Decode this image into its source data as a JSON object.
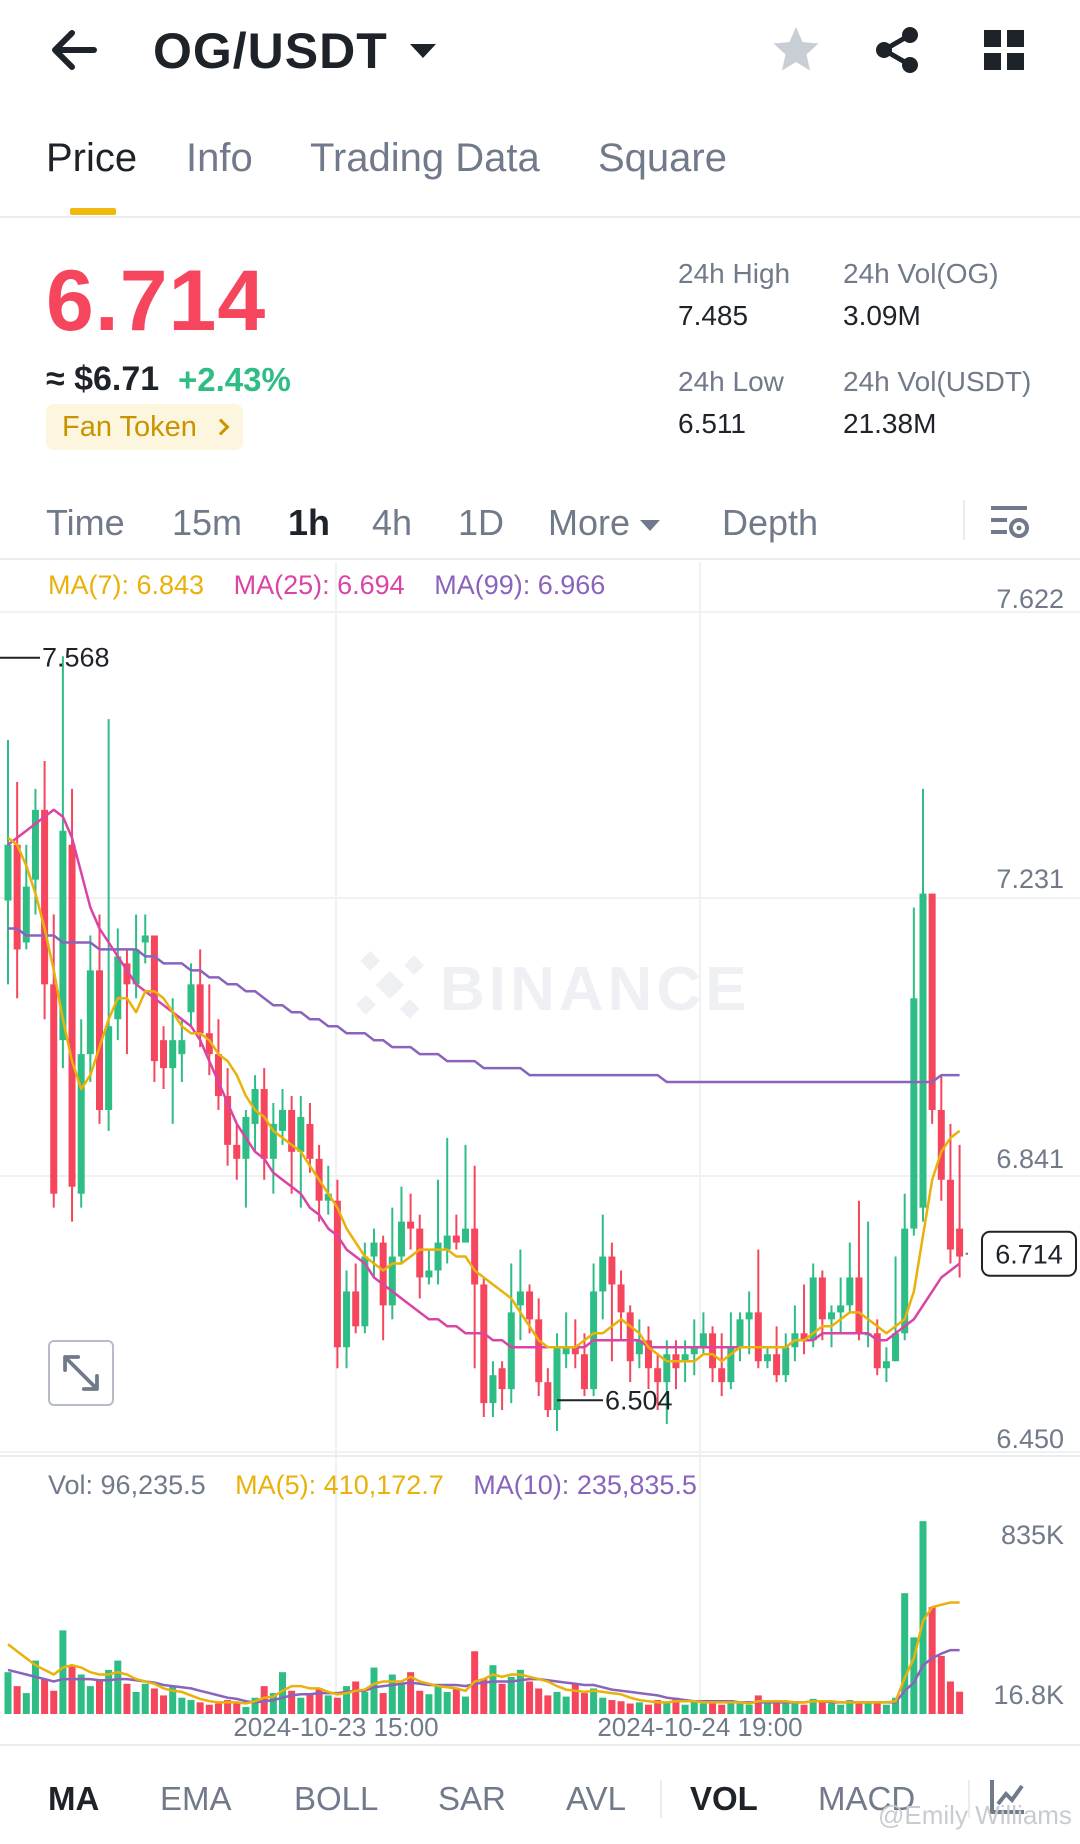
{
  "header": {
    "pair": "OG/USDT"
  },
  "tabs": [
    {
      "label": "Price",
      "active": true
    },
    {
      "label": "Info",
      "active": false
    },
    {
      "label": "Trading Data",
      "active": false
    },
    {
      "label": "Square",
      "active": false
    }
  ],
  "ticker": {
    "last_price": "6.714",
    "usd_price": "≈ $6.71",
    "change_pct": "+2.43%",
    "badge": "Fan Token",
    "stats": {
      "high_label": "24h High",
      "high_value": "7.485",
      "vol_og_label": "24h Vol(OG)",
      "vol_og_value": "3.09M",
      "low_label": "24h Low",
      "low_value": "6.511",
      "vol_usdt_label": "24h Vol(USDT)",
      "vol_usdt_value": "21.38M"
    }
  },
  "intervals": [
    {
      "label": "Time",
      "active": false
    },
    {
      "label": "15m",
      "active": false
    },
    {
      "label": "1h",
      "active": true
    },
    {
      "label": "4h",
      "active": false
    },
    {
      "label": "1D",
      "active": false
    },
    {
      "label": "More",
      "active": false
    },
    {
      "label": "Depth",
      "active": false
    }
  ],
  "indicators": [
    {
      "label": "MA",
      "active": true
    },
    {
      "label": "EMA",
      "active": false
    },
    {
      "label": "BOLL",
      "active": false
    },
    {
      "label": "SAR",
      "active": false
    },
    {
      "label": "AVL",
      "active": false
    },
    {
      "label": "VOL",
      "active": true
    },
    {
      "label": "MACD",
      "active": false
    }
  ],
  "credit": "@Emily Williams",
  "colors": {
    "up": "#2ebd85",
    "down": "#f6465d",
    "ma7": "#e9b10a",
    "ma25": "#d944a6",
    "ma99": "#8a63bd",
    "accent": "#f0b90b"
  },
  "chart_data": {
    "type": "candlestick",
    "interval": "1h",
    "watermark": "BINANCE",
    "price_axis_ticks": [
      "7.622",
      "7.231",
      "6.841",
      "6.450"
    ],
    "price_range": [
      6.45,
      7.622
    ],
    "current_price_label": "6.714",
    "max_marker": "7.568",
    "min_marker": "6.504",
    "ma_legend": [
      {
        "name": "MA(7)",
        "value": "6.843",
        "text": "MA(7): 6.843"
      },
      {
        "name": "MA(25)",
        "value": "6.694",
        "text": "MA(25): 6.694"
      },
      {
        "name": "MA(99)",
        "value": "6.966",
        "text": "MA(99): 6.966"
      }
    ],
    "x_labels": [
      "2024-10-23 15:00",
      "2024-10-24 19:00"
    ],
    "volume": {
      "axis_ticks": [
        "835K",
        "16.8K"
      ],
      "legend": [
        {
          "name": "Vol",
          "text": "Vol: 96,235.5"
        },
        {
          "name": "MA(5)",
          "text": "MA(5): 410,172.7"
        },
        {
          "name": "MA(10)",
          "text": "MA(10): 235,835.5"
        }
      ]
    },
    "candles": [
      [
        7.22,
        7.3,
        7.45,
        7.1
      ],
      [
        7.3,
        7.15,
        7.39,
        7.08
      ],
      [
        7.16,
        7.24,
        7.3,
        7.15
      ],
      [
        7.25,
        7.35,
        7.38,
        7.2
      ],
      [
        7.35,
        7.1,
        7.42,
        7.05
      ],
      [
        7.1,
        6.8,
        7.2,
        6.78
      ],
      [
        7.02,
        7.32,
        7.57,
        6.98
      ],
      [
        7.3,
        6.81,
        7.38,
        6.76
      ],
      [
        6.8,
        7.0,
        7.05,
        6.78
      ],
      [
        7.0,
        7.12,
        7.17,
        6.96
      ],
      [
        7.12,
        6.92,
        7.2,
        6.9
      ],
      [
        6.92,
        7.04,
        7.48,
        6.89
      ],
      [
        7.05,
        7.14,
        7.18,
        7.02
      ],
      [
        7.13,
        7.1,
        7.15,
        7.0
      ],
      [
        7.1,
        7.15,
        7.2,
        7.08
      ],
      [
        7.16,
        7.17,
        7.2,
        7.13
      ],
      [
        7.17,
        6.99,
        7.17,
        6.96
      ],
      [
        7.02,
        6.98,
        7.04,
        6.95
      ],
      [
        6.98,
        7.02,
        7.08,
        6.9
      ],
      [
        7.0,
        7.02,
        7.05,
        6.96
      ],
      [
        7.06,
        7.1,
        7.13,
        7.04
      ],
      [
        7.1,
        7.03,
        7.15,
        7.01
      ],
      [
        7.03,
        7.0,
        7.1,
        6.97
      ],
      [
        7.0,
        6.94,
        7.05,
        6.92
      ],
      [
        6.94,
        6.87,
        6.98,
        6.84
      ],
      [
        6.87,
        6.85,
        6.9,
        6.82
      ],
      [
        6.85,
        6.91,
        6.92,
        6.78
      ],
      [
        6.9,
        6.95,
        6.97,
        6.86
      ],
      [
        6.95,
        6.85,
        6.98,
        6.82
      ],
      [
        6.85,
        6.9,
        6.93,
        6.8
      ],
      [
        6.89,
        6.92,
        6.95,
        6.87
      ],
      [
        6.92,
        6.86,
        6.94,
        6.8
      ],
      [
        6.86,
        6.91,
        6.94,
        6.78
      ],
      [
        6.9,
        6.85,
        6.93,
        6.83
      ],
      [
        6.85,
        6.79,
        6.87,
        6.76
      ],
      [
        6.79,
        6.8,
        6.84,
        6.77
      ],
      [
        6.79,
        6.58,
        6.82,
        6.55
      ],
      [
        6.58,
        6.66,
        6.69,
        6.55
      ],
      [
        6.66,
        6.61,
        6.7,
        6.6
      ],
      [
        6.61,
        6.71,
        6.73,
        6.6
      ],
      [
        6.71,
        6.73,
        6.75,
        6.68
      ],
      [
        6.73,
        6.64,
        6.74,
        6.59
      ],
      [
        6.64,
        6.71,
        6.78,
        6.62
      ],
      [
        6.71,
        6.76,
        6.81,
        6.7
      ],
      [
        6.76,
        6.75,
        6.8,
        6.72
      ],
      [
        6.75,
        6.68,
        6.77,
        6.65
      ],
      [
        6.68,
        6.69,
        6.72,
        6.67
      ],
      [
        6.69,
        6.73,
        6.82,
        6.67
      ],
      [
        6.72,
        6.74,
        6.88,
        6.7
      ],
      [
        6.74,
        6.73,
        6.77,
        6.72
      ],
      [
        6.73,
        6.75,
        6.87,
        6.73
      ],
      [
        6.75,
        6.67,
        6.84,
        6.55
      ],
      [
        6.67,
        6.5,
        6.68,
        6.48
      ],
      [
        6.5,
        6.54,
        6.56,
        6.48
      ],
      [
        6.55,
        6.52,
        6.56,
        6.49
      ],
      [
        6.52,
        6.63,
        6.7,
        6.5
      ],
      [
        6.64,
        6.66,
        6.72,
        6.59
      ],
      [
        6.66,
        6.62,
        6.67,
        6.6
      ],
      [
        6.62,
        6.53,
        6.65,
        6.51
      ],
      [
        6.53,
        6.49,
        6.55,
        6.48
      ],
      [
        6.49,
        6.58,
        6.6,
        6.46
      ],
      [
        6.57,
        6.58,
        6.63,
        6.55
      ],
      [
        6.58,
        6.57,
        6.62,
        6.55
      ],
      [
        6.57,
        6.52,
        6.6,
        6.51
      ],
      [
        6.52,
        6.66,
        6.7,
        6.51
      ],
      [
        6.66,
        6.71,
        6.77,
        6.62
      ],
      [
        6.71,
        6.67,
        6.73,
        6.56
      ],
      [
        6.67,
        6.63,
        6.69,
        6.59
      ],
      [
        6.63,
        6.56,
        6.64,
        6.53
      ],
      [
        6.57,
        6.59,
        6.62,
        6.55
      ],
      [
        6.59,
        6.55,
        6.61,
        6.52
      ],
      [
        6.55,
        6.53,
        6.57,
        6.49
      ],
      [
        6.53,
        6.57,
        6.59,
        6.47
      ],
      [
        6.57,
        6.55,
        6.59,
        6.52
      ],
      [
        6.56,
        6.57,
        6.59,
        6.53
      ],
      [
        6.57,
        6.58,
        6.62,
        6.54
      ],
      [
        6.58,
        6.6,
        6.63,
        6.57
      ],
      [
        6.6,
        6.55,
        6.61,
        6.53
      ],
      [
        6.55,
        6.53,
        6.6,
        6.51
      ],
      [
        6.53,
        6.58,
        6.63,
        6.52
      ],
      [
        6.58,
        6.62,
        6.63,
        6.56
      ],
      [
        6.62,
        6.63,
        6.66,
        6.57
      ],
      [
        6.63,
        6.56,
        6.72,
        6.55
      ],
      [
        6.56,
        6.57,
        6.58,
        6.55
      ],
      [
        6.57,
        6.54,
        6.61,
        6.53
      ],
      [
        6.54,
        6.58,
        6.6,
        6.53
      ],
      [
        6.58,
        6.6,
        6.64,
        6.56
      ],
      [
        6.6,
        6.59,
        6.67,
        6.57
      ],
      [
        6.59,
        6.68,
        6.7,
        6.58
      ],
      [
        6.68,
        6.62,
        6.69,
        6.59
      ],
      [
        6.62,
        6.63,
        6.64,
        6.58
      ],
      [
        6.63,
        6.64,
        6.68,
        6.6
      ],
      [
        6.64,
        6.68,
        6.73,
        6.63
      ],
      [
        6.68,
        6.6,
        6.79,
        6.59
      ],
      [
        6.6,
        6.6,
        6.76,
        6.58
      ],
      [
        6.6,
        6.55,
        6.62,
        6.54
      ],
      [
        6.55,
        6.56,
        6.58,
        6.53
      ],
      [
        6.56,
        6.6,
        6.71,
        6.56
      ],
      [
        6.6,
        6.75,
        6.8,
        6.59
      ],
      [
        6.75,
        7.08,
        7.21,
        6.74
      ],
      [
        6.78,
        7.23,
        7.38,
        6.76
      ],
      [
        7.23,
        6.92,
        7.23,
        6.9
      ],
      [
        6.92,
        6.82,
        6.97,
        6.79
      ],
      [
        6.82,
        6.72,
        6.9,
        6.7
      ],
      [
        6.75,
        6.71,
        6.87,
        6.68
      ]
    ],
    "ma7": [
      7.31,
      7.3,
      7.27,
      7.23,
      7.18,
      7.12,
      7.05,
      6.99,
      6.95,
      6.97,
      7.01,
      7.05,
      7.08,
      7.08,
      7.06,
      7.09,
      7.09,
      7.08,
      7.06,
      7.04,
      7.03,
      7.03,
      7.02,
      7.0,
      6.99,
      6.97,
      6.94,
      6.92,
      6.91,
      6.89,
      6.88,
      6.87,
      6.86,
      6.84,
      6.82,
      6.8,
      6.78,
      6.75,
      6.73,
      6.71,
      6.7,
      6.69,
      6.7,
      6.7,
      6.71,
      6.72,
      6.72,
      6.72,
      6.72,
      6.71,
      6.71,
      6.69,
      6.68,
      6.67,
      6.66,
      6.65,
      6.63,
      6.61,
      6.59,
      6.58,
      6.58,
      6.58,
      6.58,
      6.59,
      6.6,
      6.6,
      6.61,
      6.62,
      6.61,
      6.6,
      6.58,
      6.57,
      6.56,
      6.56,
      6.56,
      6.56,
      6.57,
      6.57,
      6.56,
      6.57,
      6.58,
      6.58,
      6.58,
      6.58,
      6.58,
      6.58,
      6.59,
      6.59,
      6.6,
      6.61,
      6.61,
      6.62,
      6.63,
      6.63,
      6.62,
      6.61,
      6.6,
      6.61,
      6.62,
      6.66,
      6.74,
      6.82,
      6.86,
      6.88,
      6.89
    ],
    "ma25": [
      7.3,
      7.31,
      7.32,
      7.33,
      7.34,
      7.35,
      7.34,
      7.31,
      7.26,
      7.21,
      7.18,
      7.16,
      7.14,
      7.12,
      7.1,
      7.09,
      7.08,
      7.07,
      7.06,
      7.05,
      7.04,
      7.02,
      6.99,
      6.96,
      6.93,
      6.9,
      6.88,
      6.86,
      6.85,
      6.83,
      6.82,
      6.81,
      6.8,
      6.78,
      6.77,
      6.75,
      6.74,
      6.72,
      6.71,
      6.7,
      6.68,
      6.67,
      6.66,
      6.65,
      6.64,
      6.63,
      6.62,
      6.62,
      6.61,
      6.61,
      6.6,
      6.6,
      6.6,
      6.59,
      6.59,
      6.58,
      6.58,
      6.58,
      6.58,
      6.58,
      6.58,
      6.58,
      6.58,
      6.58,
      6.59,
      6.59,
      6.59,
      6.59,
      6.59,
      6.59,
      6.58,
      6.58,
      6.58,
      6.58,
      6.58,
      6.58,
      6.58,
      6.58,
      6.58,
      6.58,
      6.58,
      6.58,
      6.58,
      6.58,
      6.58,
      6.58,
      6.59,
      6.59,
      6.59,
      6.6,
      6.6,
      6.6,
      6.6,
      6.6,
      6.6,
      6.59,
      6.59,
      6.6,
      6.61,
      6.62,
      6.64,
      6.66,
      6.68,
      6.69,
      6.7
    ],
    "ma99": [
      7.18,
      7.18,
      7.17,
      7.17,
      7.17,
      7.17,
      7.16,
      7.16,
      7.16,
      7.16,
      7.15,
      7.15,
      7.15,
      7.15,
      7.15,
      7.14,
      7.14,
      7.13,
      7.13,
      7.13,
      7.12,
      7.12,
      7.11,
      7.11,
      7.1,
      7.1,
      7.09,
      7.09,
      7.08,
      7.07,
      7.07,
      7.06,
      7.06,
      7.05,
      7.05,
      7.04,
      7.04,
      7.03,
      7.03,
      7.03,
      7.02,
      7.02,
      7.01,
      7.01,
      7.01,
      7.0,
      7.0,
      7.0,
      6.99,
      6.99,
      6.99,
      6.99,
      6.98,
      6.98,
      6.98,
      6.98,
      6.98,
      6.97,
      6.97,
      6.97,
      6.97,
      6.97,
      6.97,
      6.97,
      6.97,
      6.97,
      6.97,
      6.97,
      6.97,
      6.97,
      6.97,
      6.97,
      6.96,
      6.96,
      6.96,
      6.96,
      6.96,
      6.96,
      6.96,
      6.96,
      6.96,
      6.96,
      6.96,
      6.96,
      6.96,
      6.96,
      6.96,
      6.96,
      6.96,
      6.96,
      6.96,
      6.96,
      6.96,
      6.96,
      6.96,
      6.96,
      6.96,
      6.96,
      6.96,
      6.96,
      6.96,
      6.96,
      6.97,
      6.97,
      6.97
    ],
    "volumes": [
      180,
      120,
      90,
      230,
      150,
      100,
      360,
      210,
      170,
      120,
      150,
      190,
      230,
      130,
      95,
      130,
      110,
      80,
      120,
      70,
      60,
      50,
      40,
      45,
      60,
      50,
      30,
      70,
      120,
      90,
      180,
      100,
      70,
      90,
      110,
      80,
      70,
      120,
      140,
      95,
      200,
      90,
      170,
      130,
      180,
      100,
      85,
      120,
      95,
      110,
      75,
      270,
      150,
      210,
      130,
      160,
      190,
      140,
      110,
      80,
      95,
      75,
      130,
      90,
      110,
      70,
      60,
      55,
      45,
      50,
      40,
      60,
      50,
      70,
      40,
      50,
      45,
      55,
      40,
      60,
      45,
      40,
      80,
      50,
      60,
      45,
      50,
      40,
      65,
      50,
      45,
      40,
      60,
      45,
      55,
      50,
      40,
      70,
      520,
      330,
      830,
      460,
      250,
      140,
      96
    ],
    "vol_ma5": [
      300,
      270,
      240,
      210,
      190,
      170,
      200,
      210,
      200,
      180,
      170,
      170,
      180,
      170,
      150,
      140,
      130,
      110,
      100,
      95,
      80,
      65,
      55,
      50,
      50,
      50,
      45,
      55,
      70,
      75,
      100,
      120,
      120,
      110,
      110,
      95,
      85,
      90,
      100,
      105,
      130,
      140,
      140,
      140,
      160,
      140,
      130,
      120,
      115,
      110,
      100,
      140,
      150,
      170,
      160,
      170,
      170,
      160,
      150,
      140,
      120,
      105,
      100,
      95,
      100,
      95,
      90,
      85,
      70,
      60,
      55,
      50,
      50,
      55,
      55,
      55,
      50,
      50,
      50,
      50,
      50,
      45,
      55,
      55,
      55,
      55,
      50,
      50,
      55,
      55,
      55,
      50,
      50,
      50,
      50,
      50,
      50,
      55,
      155,
      240,
      400,
      460,
      470,
      480,
      480
    ],
    "vol_ma10": [
      190,
      180,
      170,
      160,
      150,
      140,
      150,
      150,
      150,
      150,
      145,
      145,
      150,
      150,
      145,
      140,
      135,
      125,
      120,
      115,
      110,
      100,
      90,
      80,
      70,
      65,
      55,
      50,
      55,
      60,
      70,
      80,
      85,
      85,
      90,
      90,
      90,
      95,
      100,
      100,
      115,
      120,
      125,
      130,
      135,
      130,
      125,
      125,
      125,
      125,
      120,
      130,
      135,
      140,
      140,
      140,
      145,
      150,
      150,
      145,
      140,
      135,
      130,
      125,
      125,
      115,
      105,
      100,
      95,
      90,
      85,
      80,
      70,
      65,
      60,
      55,
      55,
      55,
      55,
      55,
      50,
      50,
      50,
      50,
      50,
      50,
      50,
      50,
      55,
      55,
      50,
      50,
      50,
      50,
      50,
      50,
      50,
      50,
      100,
      135,
      210,
      240,
      260,
      275,
      275
    ]
  }
}
